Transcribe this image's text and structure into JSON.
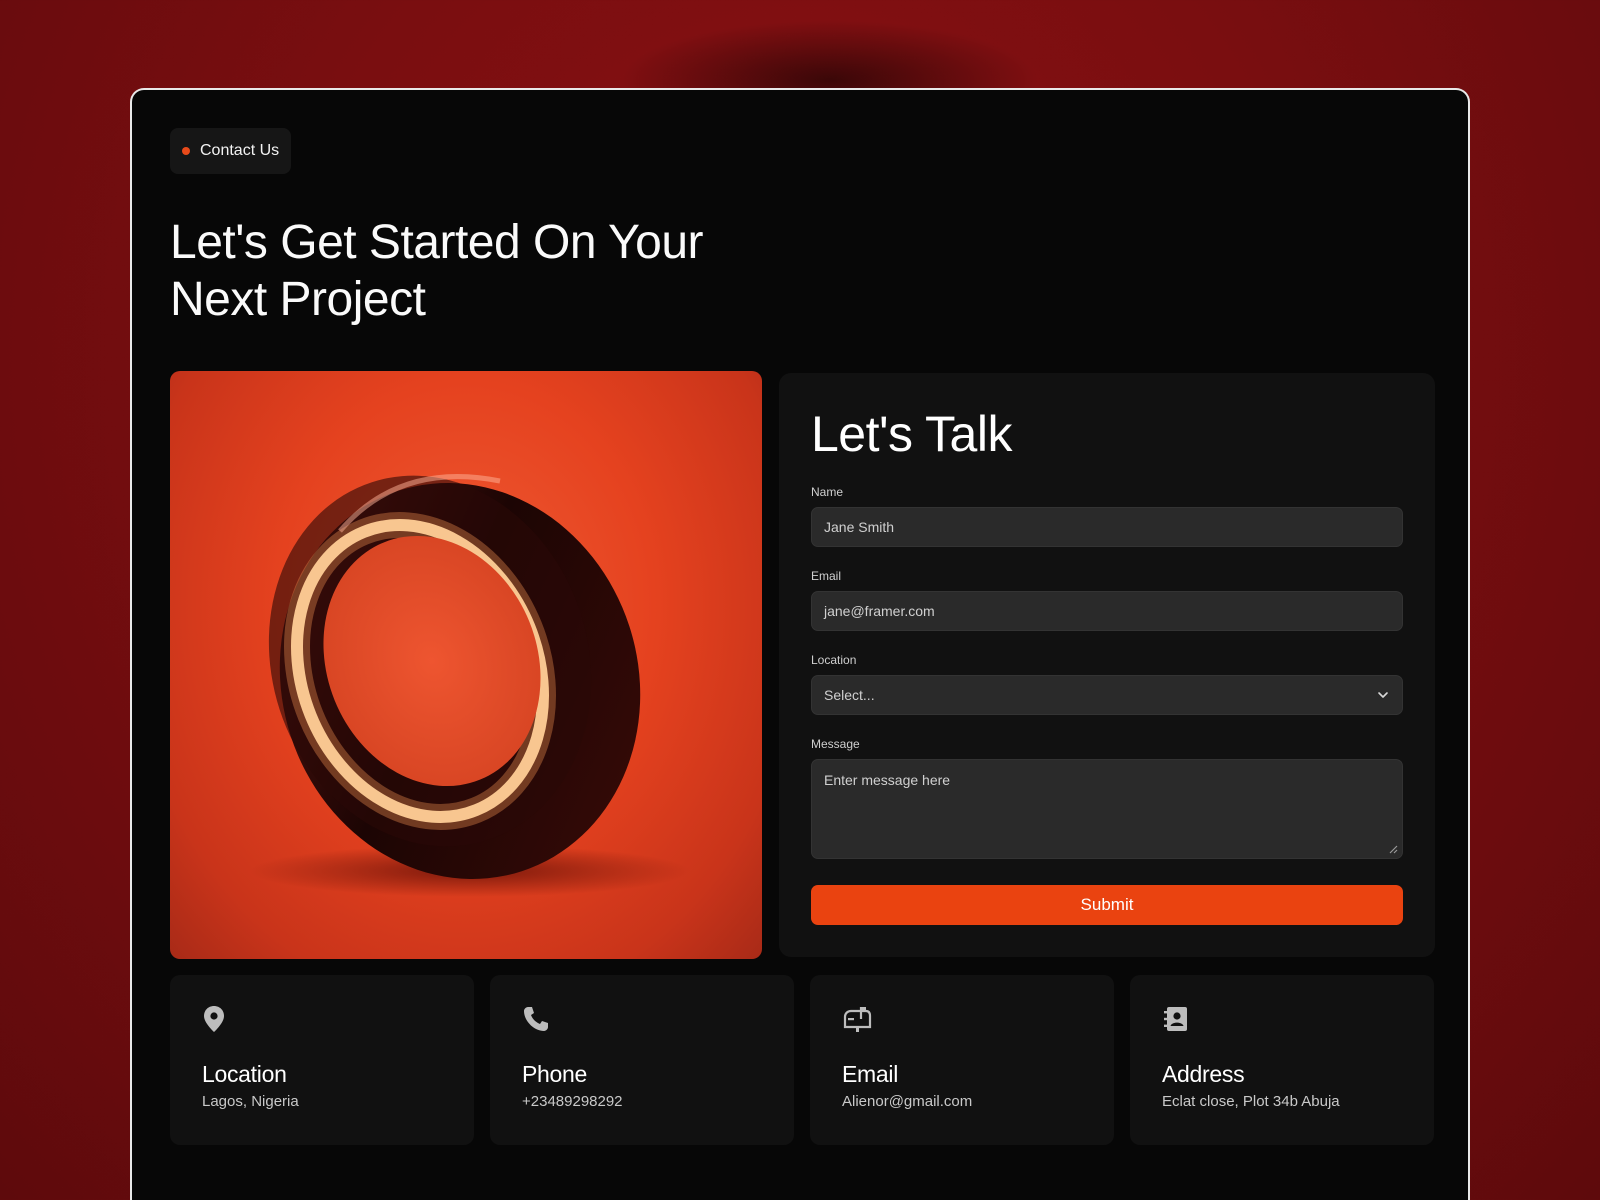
{
  "badge": {
    "label": "Contact Us"
  },
  "headline": {
    "line1": "Let's Get Started On Your",
    "line2": "Next Project"
  },
  "form": {
    "title": "Let's Talk",
    "name": {
      "label": "Name",
      "placeholder": "Jane Smith"
    },
    "email": {
      "label": "Email",
      "placeholder": "jane@framer.com"
    },
    "location": {
      "label": "Location",
      "selected": "Select..."
    },
    "message": {
      "label": "Message",
      "placeholder": "Enter message here"
    },
    "submit_label": "Submit"
  },
  "info": [
    {
      "icon": "location-pin-icon",
      "title": "Location",
      "value": "Lagos, Nigeria"
    },
    {
      "icon": "phone-icon",
      "title": "Phone",
      "value": "+23489298292"
    },
    {
      "icon": "mailbox-icon",
      "title": "Email",
      "value": "Alienor@gmail.com"
    },
    {
      "icon": "contact-book-icon",
      "title": "Address",
      "value": "Eclat close, Plot 34b Abuja"
    }
  ],
  "colors": {
    "accent": "#ea4310",
    "background": "#7a0e10",
    "frame": "#070707",
    "card": "#111111",
    "field": "#2a2a2a"
  }
}
